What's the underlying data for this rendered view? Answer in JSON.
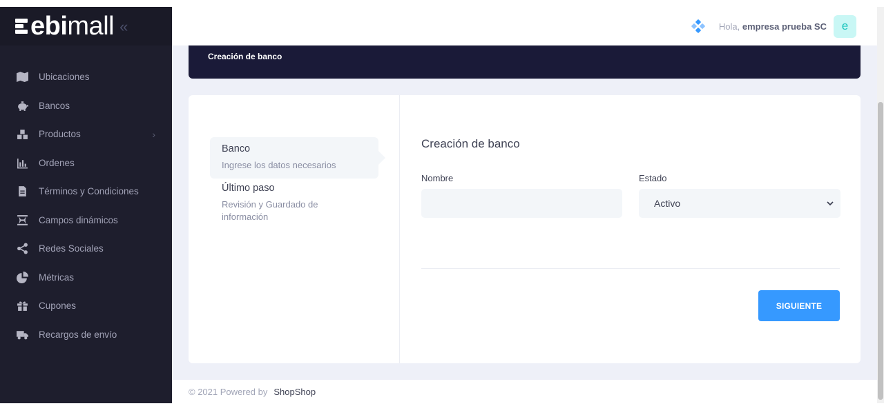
{
  "brand": {
    "logo_bold": "ebi",
    "logo_light": "mall",
    "collapse_glyph": "«"
  },
  "sidebar": {
    "items": [
      {
        "label": "Ubicaciones",
        "icon": "map-icon"
      },
      {
        "label": "Bancos",
        "icon": "piggy-bank-icon"
      },
      {
        "label": "Productos",
        "icon": "boxes-icon",
        "has_submenu": true
      },
      {
        "label": "Ordenes",
        "icon": "bar-chart-icon"
      },
      {
        "label": "Términos y Condiciones",
        "icon": "document-icon"
      },
      {
        "label": "Campos dinámicos",
        "icon": "fields-icon"
      },
      {
        "label": "Redes Sociales",
        "icon": "share-icon"
      },
      {
        "label": "Métricas",
        "icon": "pie-chart-icon"
      },
      {
        "label": "Cupones",
        "icon": "gift-icon"
      },
      {
        "label": "Recargos de envío",
        "icon": "truck-icon"
      }
    ],
    "chevron": "›"
  },
  "header": {
    "greeting_prefix": "Hola,",
    "user_name": "empresa prueba SC",
    "avatar_letter": "e"
  },
  "subheader": {
    "title": "Creación de banco"
  },
  "wizard": {
    "steps": [
      {
        "title": "Banco",
        "description": "Ingrese los datos necesarios",
        "active": true
      },
      {
        "title": "Último paso",
        "description": "Revisión y Guardado de información",
        "active": false
      }
    ],
    "form_title": "Creación de banco",
    "fields": {
      "nombre": {
        "label": "Nombre",
        "value": "",
        "placeholder": ""
      },
      "estado": {
        "label": "Estado",
        "value": "Activo"
      }
    },
    "next_button": "SIGUIENTE"
  },
  "footer": {
    "copyright": "© 2021 Powered by",
    "brand": "ShopShop"
  },
  "colors": {
    "sidebar": "#1e1e2d",
    "accent": "#3699ff",
    "subheader": "#1a1a38",
    "content_bg": "#eef0f8"
  }
}
